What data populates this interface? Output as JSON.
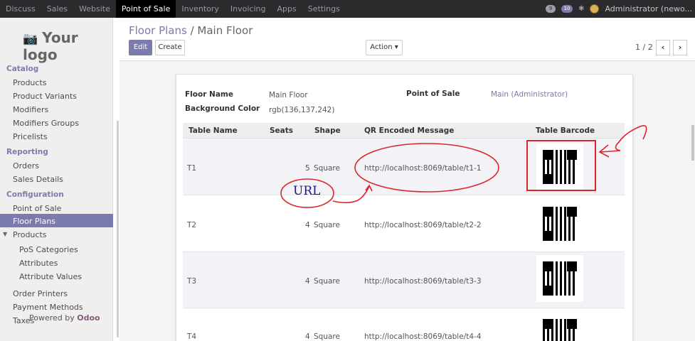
{
  "topbar": {
    "menu": [
      "Discuss",
      "Sales",
      "Website",
      "Point of Sale",
      "Inventory",
      "Invoicing",
      "Apps",
      "Settings"
    ],
    "active_index": 3,
    "chat_badge": "9",
    "message_badge": "10",
    "user": "Administrator (newo..."
  },
  "sidebar": {
    "logo_text": "Your logo",
    "sections": [
      {
        "title": "Catalog",
        "items": [
          "Products",
          "Product Variants",
          "Modifiers",
          "Modifiers Groups",
          "Pricelists"
        ]
      },
      {
        "title": "Reporting",
        "items": [
          "Orders",
          "Sales Details"
        ]
      },
      {
        "title": "Configuration",
        "items": [
          "Point of Sale",
          "Floor Plans",
          "Products",
          "PoS Categories",
          "Attributes",
          "Attribute Values",
          "Order Printers",
          "Payment Methods",
          "Taxes"
        ]
      }
    ],
    "active_item": "Floor Plans",
    "powered_prefix": "Powered by",
    "powered_brand": "Odoo"
  },
  "control_panel": {
    "breadcrumb_parent": "Floor Plans",
    "breadcrumb_sep": " / ",
    "breadcrumb_current": "Main Floor",
    "edit_label": "Edit",
    "create_label": "Create",
    "action_label": "Action",
    "pager": "1 / 2"
  },
  "form": {
    "floor_name_label": "Floor Name",
    "floor_name_value": "Main Floor",
    "bg_color_label": "Background Color",
    "bg_color_value": "rgb(136,137,242)",
    "pos_label": "Point of Sale",
    "pos_value": "Main (Administrator)"
  },
  "table": {
    "headers": [
      "Table Name",
      "Seats",
      "Shape",
      "QR Encoded Message",
      "Table Barcode"
    ],
    "rows": [
      {
        "name": "T1",
        "seats": "5",
        "shape": "Square",
        "qr": "http://localhost:8069/table/t1-1"
      },
      {
        "name": "T2",
        "seats": "4",
        "shape": "Square",
        "qr": "http://localhost:8069/table/t2-2"
      },
      {
        "name": "T3",
        "seats": "4",
        "shape": "Square",
        "qr": "http://localhost:8069/table/t3-3"
      },
      {
        "name": "T4",
        "seats": "4",
        "shape": "Square",
        "qr": "http://localhost:8069/table/t4-4"
      }
    ]
  },
  "annotation": {
    "url_label": "URL",
    "color": "#d9262a"
  },
  "colors": {
    "accent": "#7c7bad",
    "topbar": "#2b2a2c",
    "annotation": "#d9262a"
  }
}
